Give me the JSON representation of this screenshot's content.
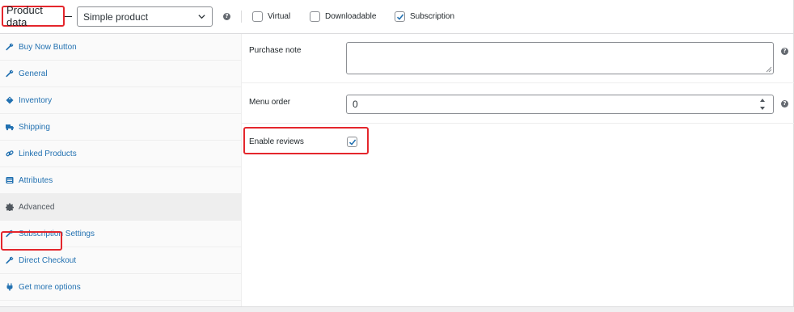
{
  "header": {
    "title": "Product data",
    "product_type": "Simple product",
    "help_glyph": "?",
    "options": [
      {
        "label": "Virtual",
        "checked": false
      },
      {
        "label": "Downloadable",
        "checked": false
      },
      {
        "label": "Subscription",
        "checked": true
      }
    ]
  },
  "sidebar": {
    "tabs": [
      {
        "label": "Buy Now Button",
        "icon": "wrench-icon",
        "active": false
      },
      {
        "label": "General",
        "icon": "wrench-icon",
        "active": false
      },
      {
        "label": "Inventory",
        "icon": "tag-icon",
        "active": false
      },
      {
        "label": "Shipping",
        "icon": "truck-icon",
        "active": false
      },
      {
        "label": "Linked Products",
        "icon": "link-icon",
        "active": false
      },
      {
        "label": "Attributes",
        "icon": "list-icon",
        "active": false
      },
      {
        "label": "Advanced",
        "icon": "gear-icon",
        "active": true
      },
      {
        "label": "Subscription Settings",
        "icon": "wrench-icon",
        "active": false
      },
      {
        "label": "Direct Checkout",
        "icon": "wrench-icon",
        "active": false
      },
      {
        "label": "Get more options",
        "icon": "plugin-icon",
        "active": false
      }
    ]
  },
  "advanced": {
    "purchase_note_label": "Purchase note",
    "purchase_note_value": "",
    "menu_order_label": "Menu order",
    "menu_order_value": "0",
    "enable_reviews_label": "Enable reviews",
    "enable_reviews_checked": true
  },
  "colors": {
    "link": "#2271b1",
    "highlight": "#e4262c",
    "active_tab_bg": "#eeeeee"
  }
}
